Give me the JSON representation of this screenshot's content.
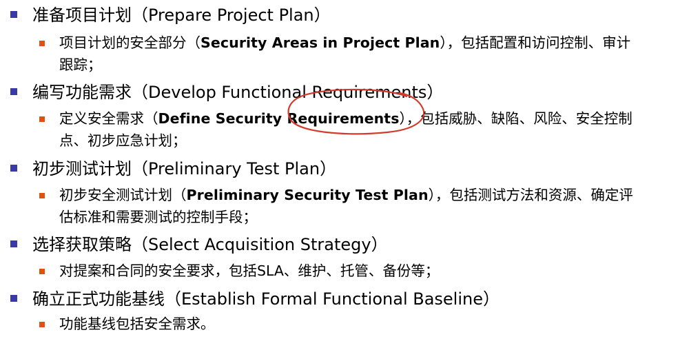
{
  "sections": [
    {
      "title": "准备项目计划（Prepare Project Plan）",
      "detail_prefix": "项目计划的安全部分（",
      "detail_bold": "Security Areas in Project Plan",
      "detail_suffix_line1": "），包括配置和访问控制、审计",
      "detail_line2": "跟踪；"
    },
    {
      "title": "编写功能需求（Develop Functional Requirements）",
      "detail_prefix": "定义安全需求（",
      "detail_bold": "Define Security Requirements",
      "detail_suffix_line1": "），包括威胁、缺陷、风险、安全控制",
      "detail_line2": "点、初步应急计划；"
    },
    {
      "title": "初步测试计划（Preliminary Test Plan）",
      "detail_prefix": "初步安全测试计划（",
      "detail_bold": "Preliminary Security Test Plan",
      "detail_suffix_line1": "），包括测试方法和资源、确定评",
      "detail_line2": "估标准和需要测试的控制手段；"
    },
    {
      "title": "选择获取策略（Select Acquisition Strategy）",
      "detail_line1": "对提案和合同的安全要求，包括SLA、维护、托管、备份等；"
    },
    {
      "title": "确立正式功能基线（Establish Formal Functional Baseline）",
      "detail_line1": "功能基线包括安全需求。"
    }
  ],
  "colors": {
    "level1_bullet": "#3a3aa5",
    "level2_bullet": "#e05010",
    "annotation_ink": "#d23a2a"
  }
}
